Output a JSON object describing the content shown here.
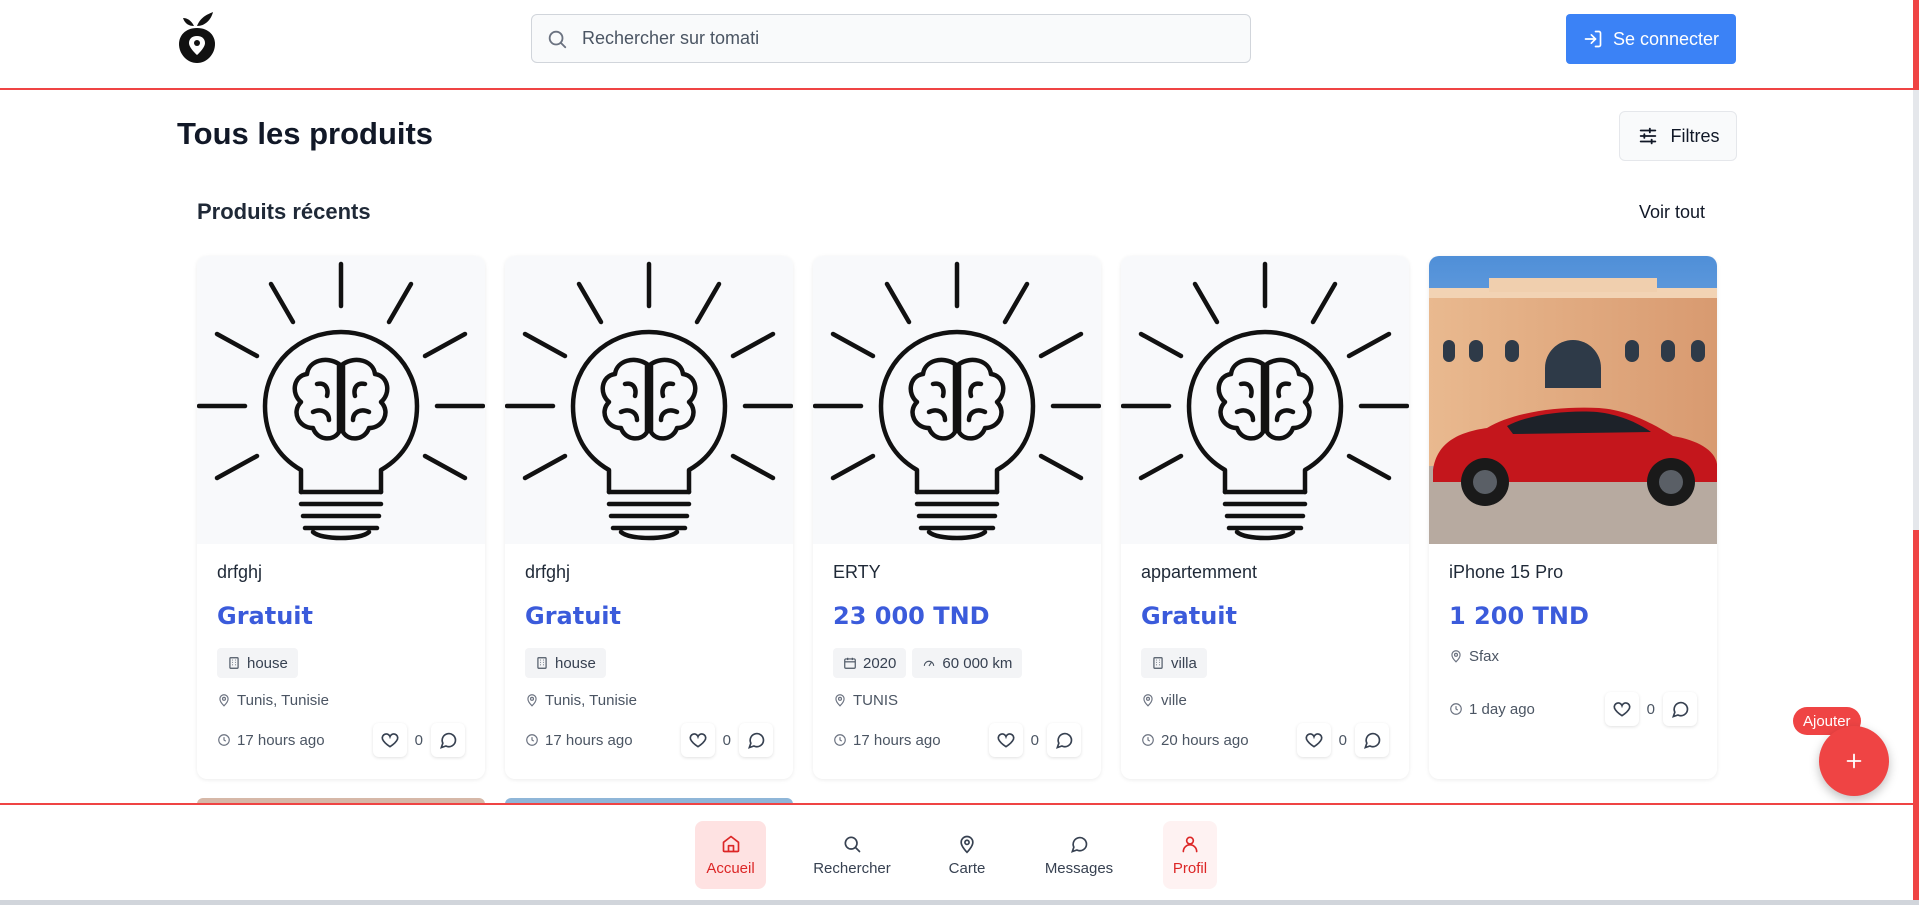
{
  "header": {
    "search_placeholder": "Rechercher sur tomati",
    "login_label": "Se connecter"
  },
  "main": {
    "title": "Tous les produits",
    "filters_label": "Filtres",
    "section_title": "Produits récents",
    "see_all": "Voir tout"
  },
  "cards": [
    {
      "title": "drfghj",
      "price": "Gratuit",
      "chips": [
        "house"
      ],
      "location": "Tunis, Tunisie",
      "time": "17 hours ago",
      "likes": "0",
      "image": "lightbulb-brain"
    },
    {
      "title": "drfghj",
      "price": "Gratuit",
      "chips": [
        "house"
      ],
      "location": "Tunis, Tunisie",
      "time": "17 hours ago",
      "likes": "0",
      "image": "lightbulb-brain"
    },
    {
      "title": "ERTY",
      "price": "23 000 TND",
      "chips": [
        "2020",
        "60 000 km"
      ],
      "location": "TUNIS",
      "time": "17 hours ago",
      "likes": "0",
      "image": "lightbulb-brain"
    },
    {
      "title": "appartemment",
      "price": "Gratuit",
      "chips": [
        "villa"
      ],
      "location": "ville",
      "time": "20 hours ago",
      "likes": "0",
      "image": "lightbulb-brain"
    },
    {
      "title": "iPhone 15 Pro",
      "price": "1 200 TND",
      "chips": [],
      "location": "Sfax",
      "time": "1 day ago",
      "likes": "0",
      "image": "red-car"
    }
  ],
  "fab": {
    "label": "Ajouter"
  },
  "nav": {
    "home": "Accueil",
    "search": "Rechercher",
    "map": "Carte",
    "messages": "Messages",
    "profile": "Profil"
  },
  "colors": {
    "accent_red": "#ef4444",
    "primary_blue": "#3b82f6",
    "price_blue": "#3b5bdb"
  }
}
